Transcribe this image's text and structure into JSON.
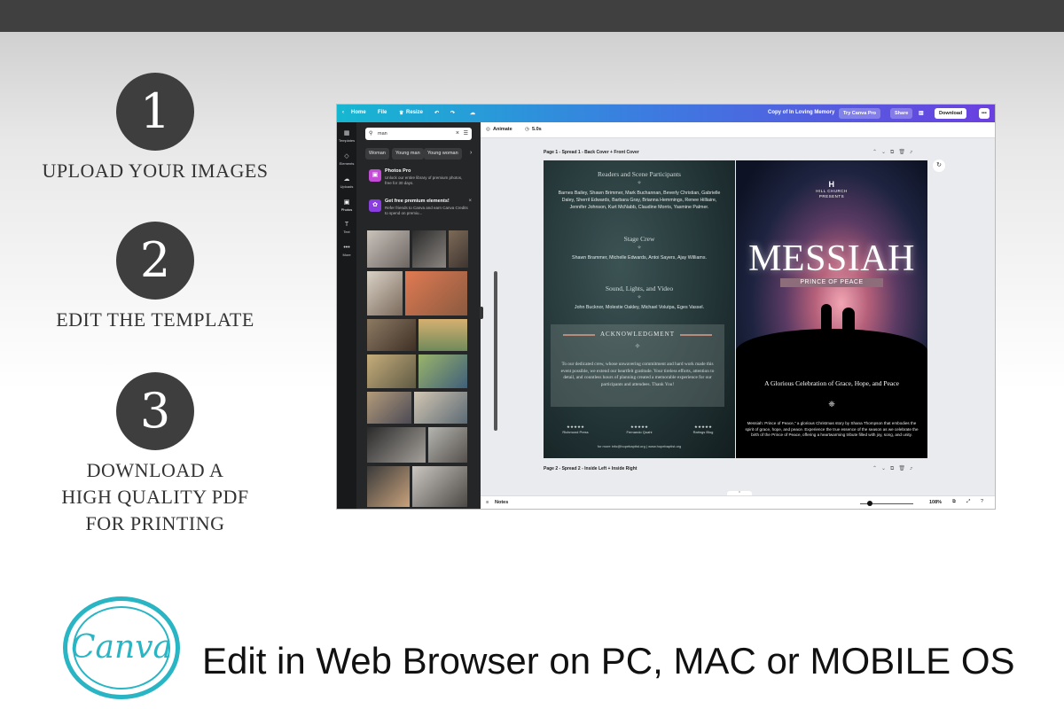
{
  "steps": [
    {
      "number": "1",
      "text_lines": [
        "UPLOAD YOUR IMAGES"
      ]
    },
    {
      "number": "2",
      "text_lines": [
        "EDIT THE TEMPLATE"
      ]
    },
    {
      "number": "3",
      "text_lines": [
        "DOWNLOAD A",
        "HIGH QUALITY PDF",
        "FOR PRINTING"
      ]
    }
  ],
  "editor": {
    "topbar": {
      "home": "Home",
      "file": "File",
      "resize": "Resize",
      "doc_title": "Copy of In Loving Memory",
      "try_pro": "Try Canva Pro",
      "share": "Share",
      "download": "Download",
      "more": "•••",
      "colors": {
        "start": "#16b7d1",
        "end": "#6b3fe0"
      }
    },
    "rail": [
      "Templates",
      "Elements",
      "Uploads",
      "Photos",
      "Text",
      "More"
    ],
    "panel": {
      "search_value": "man",
      "chips": [
        "Woman",
        "Young man",
        "Young woman"
      ],
      "promo1": {
        "title": "Photos Pro",
        "desc": "Unlock our entire library of premium photos, free for 30 days."
      },
      "promo2": {
        "title": "Get free premium elements!",
        "desc": "Refer friends to Canva and earn Canva Credits to spend on premiu..."
      }
    },
    "toolbar": {
      "animate": "Animate",
      "duration": "5.0s"
    },
    "pages": {
      "page1_label": "Page 1 - Spread 1 - Back Cover + Front Cover",
      "page2_label": "Page 2 - Spread 2 - Inside Left + Inside Right"
    },
    "back_cover": {
      "h1": "Readers and Scene Participants",
      "p1": "Barnes Bailey, Shawn Brimmer, Mark Buchannan, Beverly Christian, Gabrielle Daley, Sherril Edwards, Barbara Gray, Brianna Hemmings, Renee Hilliaire, Jennifer Johnson, Kurt McNabb, Claudine Morris, Yasmine Palmer.",
      "h2": "Stage Crew",
      "p2": "Shawn Brammer, Michelle Edwards, Antoi Sayers, Ajay Williams.",
      "h3": "Sound, Lights, and Video",
      "p3": "John Bucknor, Molestie Oakley, Michael Volutpa, Eges Vassel.",
      "ack_title": "ACKNOWLEDGMENT",
      "ack_text": "To our dedicated crew, whose unwavering commitment and hard work made this event possible, we extend our heartfelt gratitude. Your tireless efforts, attention to detail, and countless hours of planning created a memorable experience for our participants and attendees. Thank You!",
      "reviews": [
        {
          "stars": "★★★★★",
          "name": "Richmond Press"
        },
        {
          "stars": "★★★★★",
          "name": "Fernando Quahi"
        },
        {
          "stars": "★★★★★",
          "name": "Ratings Blog"
        }
      ],
      "footer": "for more info@hopebaptist.org | www.hopebaptist.org"
    },
    "front_cover": {
      "church_logo": "H",
      "church_name": "HILL CHURCH",
      "presents": "PRESENTS",
      "title": "MESSIAH",
      "subtitle": "PRINCE OF PEACE",
      "tagline": "A Glorious Celebration of Grace, Hope, and Peace",
      "desc": "Messiah: Prince of Peace,\" a glorious Christmas story by Shana Thompson that embodies the spirit of grace, hope, and peace. Experience the true essence of the season as we celebrate the birth of the Prince of Peace, offering a heartwarming tribute filled with joy, song, and unity."
    },
    "bottom": {
      "notes": "Notes",
      "zoom": "108%"
    }
  },
  "footer": {
    "logo_text": "Canva",
    "text": "Edit in Web Browser on PC, MAC or MOBILE OS",
    "logo_color": "#2ab5c4"
  }
}
